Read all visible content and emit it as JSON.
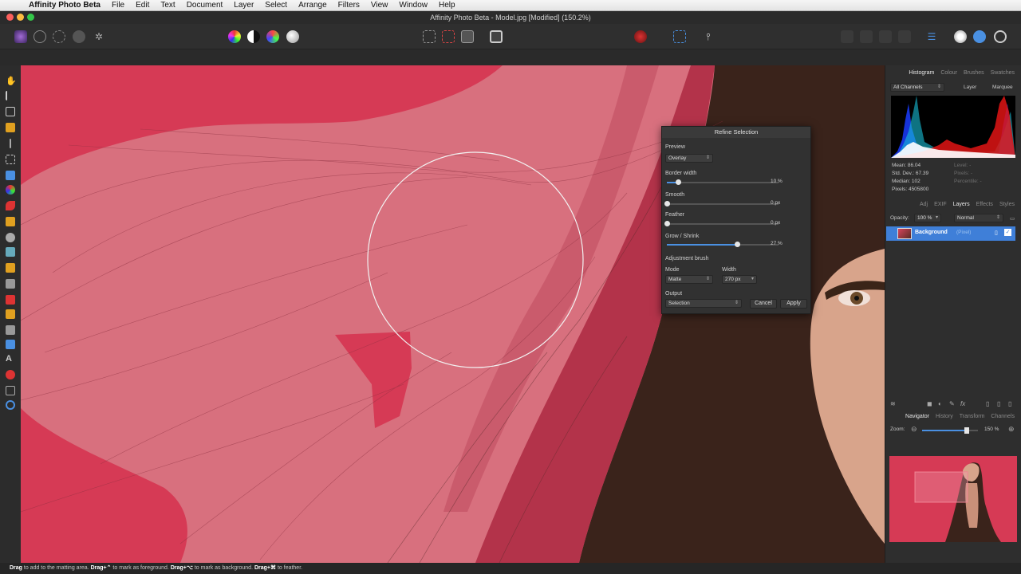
{
  "menubar": {
    "app_name": "Affinity Photo Beta",
    "items": [
      "File",
      "Edit",
      "Text",
      "Document",
      "Layer",
      "Select",
      "Arrange",
      "Filters",
      "View",
      "Window",
      "Help"
    ]
  },
  "window": {
    "title": "Affinity Photo Beta - Model.jpg [Modified] (150.2%)"
  },
  "refine": {
    "title": "Refine Selection",
    "preview_label": "Preview",
    "preview_value": "Overlay",
    "border_width_label": "Border width",
    "border_width_value": "10 %",
    "border_width_level": 0.1,
    "smooth_label": "Smooth",
    "smooth_value": "0 px",
    "feather_label": "Feather",
    "feather_value": "0 px",
    "grow_label": "Grow / Shrink",
    "grow_value": "27 %",
    "grow_level": 0.63,
    "adj_brush_label": "Adjustment brush",
    "mode_label": "Mode",
    "mode_value": "Matte",
    "width_label": "Width",
    "width_value": "270 px",
    "output_label": "Output",
    "output_value": "Selection",
    "cancel_label": "Cancel",
    "apply_label": "Apply"
  },
  "histogram": {
    "tabs": [
      "Histogram",
      "Colour",
      "Brushes",
      "Swatches"
    ],
    "channel_select": "All Channels",
    "layer_label": "Layer",
    "marquee_label": "Marquee",
    "stats_left": [
      "Mean: 86.04",
      "Std. Dev.: 67.39",
      "Median: 102",
      "Pixels: 4505800"
    ],
    "stats_right": [
      "Level: -",
      "Pixels: -",
      "Percentile: -"
    ]
  },
  "layers": {
    "tabs": [
      "Adj",
      "EXIF",
      "Layers",
      "Effects",
      "Styles"
    ],
    "opacity_label": "Opacity:",
    "opacity_value": "100 %",
    "blend_mode": "Normal",
    "layer_name": "Background",
    "layer_type": "(Pixel)"
  },
  "navigator": {
    "tabs": [
      "Navigator",
      "History",
      "Transform",
      "Channels"
    ],
    "zoom_label": "Zoom:",
    "zoom_value": "150 %",
    "zoom_level": 0.8
  },
  "statusbar": {
    "parts": [
      {
        "b": "Drag",
        "t": " to add to the matting area. "
      },
      {
        "b": "Drag+⌃",
        "t": " to mark as foreground. "
      },
      {
        "b": "Drag+⌥",
        "t": " to mark as background. "
      },
      {
        "b": "Drag+⌘",
        "t": " to feather."
      }
    ]
  },
  "colors": {
    "overlay_red": "#d63a55",
    "overlay_pink": "#d8707e",
    "accent_blue": "#3f7fd8",
    "hair_dark": "#3a231b",
    "skin": "#d8a48b"
  }
}
